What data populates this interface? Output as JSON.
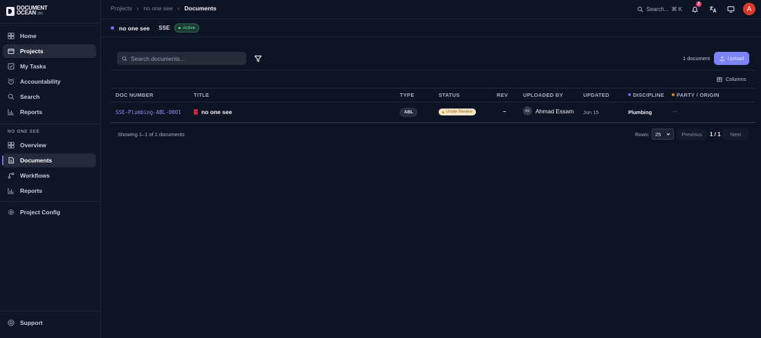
{
  "app": {
    "logo_line1": "DOCUMENT",
    "logo_line2": "OCEAN",
    "logo_sub": "360"
  },
  "sidebar": {
    "main_items": [
      {
        "label": "Home",
        "icon": "home-icon"
      },
      {
        "label": "Projects",
        "icon": "projects-icon",
        "active": true
      },
      {
        "label": "My Tasks",
        "icon": "tasks-icon"
      },
      {
        "label": "Accountability",
        "icon": "alarm-icon"
      },
      {
        "label": "Search",
        "icon": "search-icon"
      },
      {
        "label": "Reports",
        "icon": "chart-icon"
      }
    ],
    "section_label": "NO ONE SEE",
    "project_items": [
      {
        "label": "Overview",
        "icon": "overview-icon"
      },
      {
        "label": "Documents",
        "icon": "document-icon",
        "active": true
      },
      {
        "label": "Workflows",
        "icon": "workflow-icon"
      },
      {
        "label": "Reports",
        "icon": "chart-icon"
      }
    ],
    "config_item": {
      "label": "Project Config",
      "icon": "gear-icon"
    },
    "bottom_items": [
      {
        "label": "Support",
        "icon": "support-icon"
      }
    ]
  },
  "topbar": {
    "breadcrumb": [
      "Projects",
      "no one see",
      "Documents"
    ],
    "search_label": "Search...",
    "search_shortcut": "⌘ K",
    "notification_count": "2",
    "avatar_initial": "A"
  },
  "project": {
    "name": "no one see",
    "code": "SSE",
    "status": "Active"
  },
  "toolbar": {
    "search_placeholder": "Search documents...",
    "doc_count": "1 document",
    "upload_label": "Upload",
    "columns_label": "Columns"
  },
  "table": {
    "headers": {
      "doc_number": "DOC NUMBER",
      "title": "TITLE",
      "type": "TYPE",
      "status": "STATUS",
      "rev": "REV",
      "uploaded_by": "UPLOADED BY",
      "updated": "UPDATED",
      "discipline": "DISCIPLINE",
      "party": "PARTY / ORIGIN"
    },
    "rows": [
      {
        "doc_number": "SSE-Plumbing-ABL-0001",
        "title": "no one see",
        "type": "ABL",
        "status": "Under Review",
        "rev": "–",
        "uploader_initials": "AE",
        "uploader": "Ahmad Essam",
        "updated": "Jun 15",
        "discipline": "Plumbing",
        "party": "—"
      }
    ]
  },
  "footer": {
    "showing": "Showing 1–1 of 1 documents",
    "rows_label": "Rows:",
    "rows_value": "25",
    "prev_label": "Previous",
    "page_indicator": "1 / 1",
    "next_label": "Next"
  },
  "colors": {
    "accent": "#7c83f5",
    "discipline_dot": "#6a6ff2",
    "party_dot": "#e8862a",
    "active_status": "#6ee0ad",
    "review_status": "#d0891f"
  }
}
